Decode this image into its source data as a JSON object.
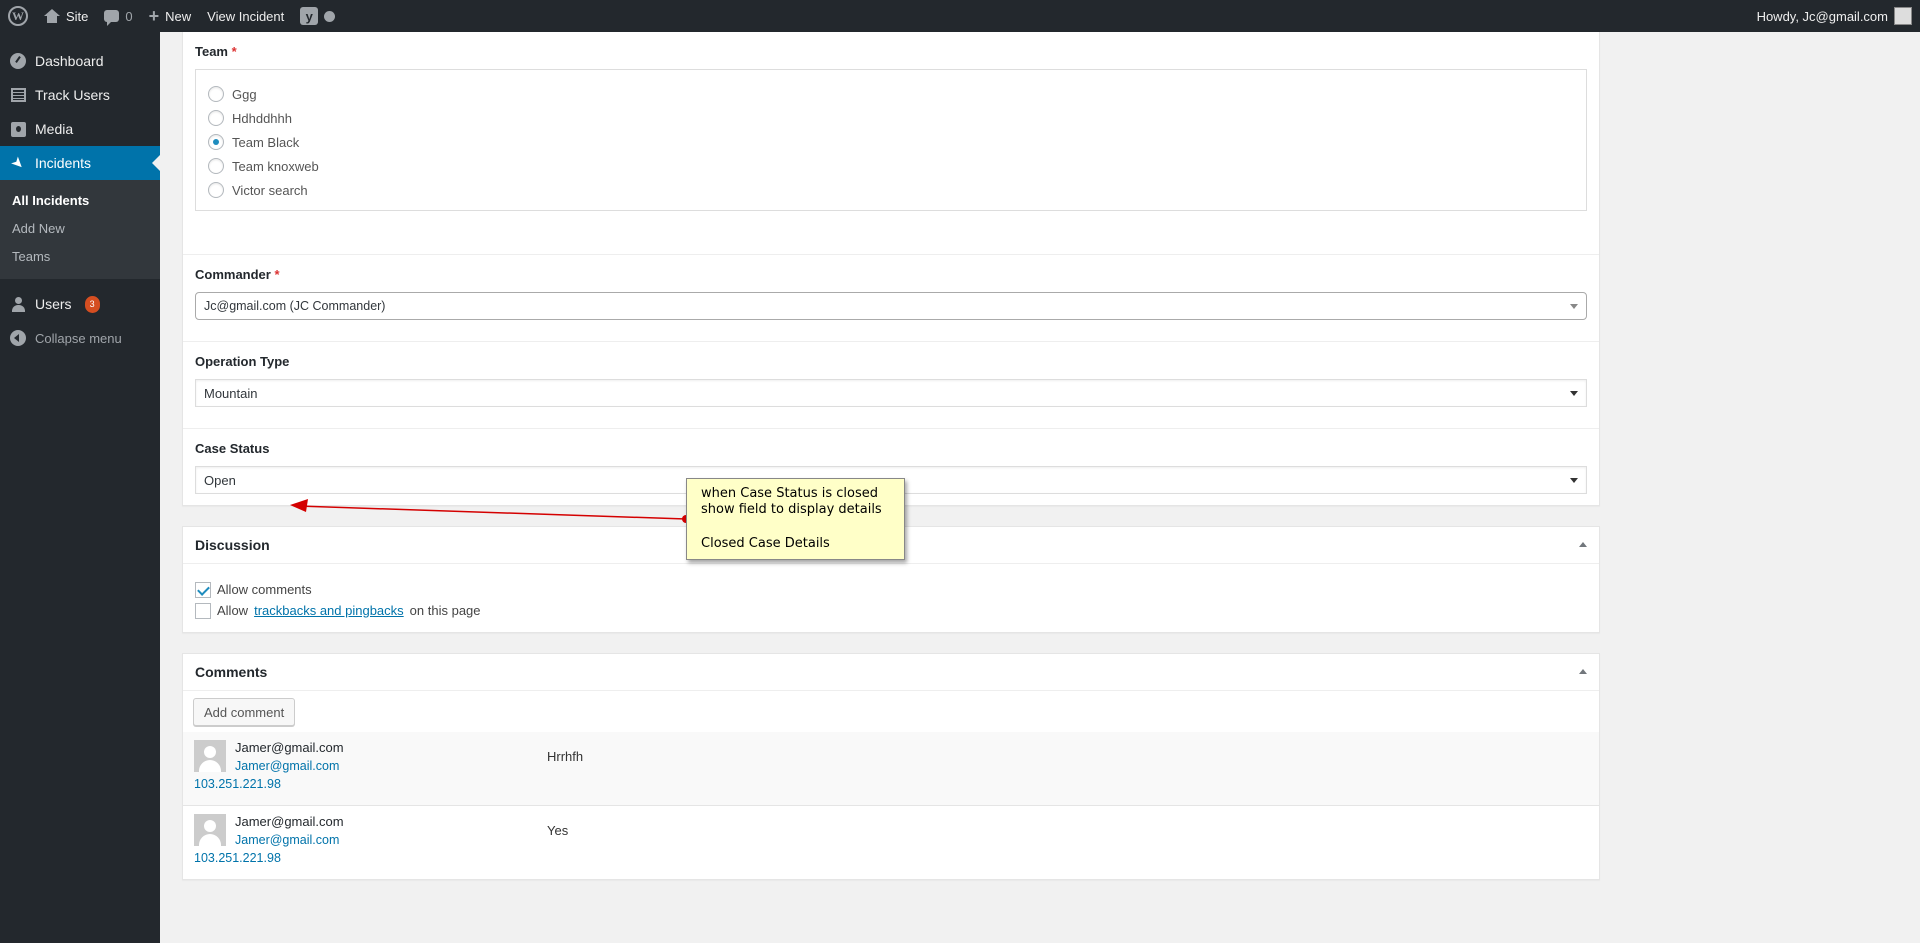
{
  "adminbar": {
    "site_label": "Site",
    "comments_count": "0",
    "new_label": "New",
    "view_label": "View Incident",
    "greeting": "Howdy, Jc@gmail.com"
  },
  "sidebar": {
    "items": [
      {
        "label": "Dashboard",
        "icon": "dashboard-icon"
      },
      {
        "label": "Track Users",
        "icon": "table-icon"
      },
      {
        "label": "Media",
        "icon": "media-icon"
      },
      {
        "label": "Incidents",
        "icon": "pin-icon"
      }
    ],
    "submenu": [
      "All Incidents",
      "Add New",
      "Teams"
    ],
    "users_label": "Users",
    "users_badge": "3",
    "collapse_label": "Collapse menu"
  },
  "form": {
    "team": {
      "label": "Team",
      "required": "*",
      "options": [
        "Ggg",
        "Hdhddhhh",
        "Team Black",
        "Team knoxweb",
        "Victor search"
      ],
      "selected": "Team Black"
    },
    "commander": {
      "label": "Commander",
      "required": "*",
      "value": "Jc@gmail.com (JC Commander)"
    },
    "operation_type": {
      "label": "Operation Type",
      "value": "Mountain"
    },
    "case_status": {
      "label": "Case Status",
      "value": "Open"
    }
  },
  "discussion": {
    "title": "Discussion",
    "allow_comments": "Allow comments",
    "allow_prefix": "Allow",
    "trackbacks_link": "trackbacks and pingbacks",
    "allow_suffix": "on this page"
  },
  "comments": {
    "title": "Comments",
    "add_button": "Add comment",
    "items": [
      {
        "author": "Jamer@gmail.com",
        "email": "Jamer@gmail.com",
        "ip": "103.251.221.98",
        "text": "Hrrhfh"
      },
      {
        "author": "Jamer@gmail.com",
        "email": "Jamer@gmail.com",
        "ip": "103.251.221.98",
        "text": "Yes"
      }
    ]
  },
  "annotation": {
    "line1": "when Case Status is closed",
    "line2": "show field to display details",
    "line3": "Closed Case Details",
    "arrow_color": "#d40000"
  },
  "colors": {
    "accent": "#0073aa",
    "adminbar": "#23282d",
    "badge": "#d54e21"
  }
}
